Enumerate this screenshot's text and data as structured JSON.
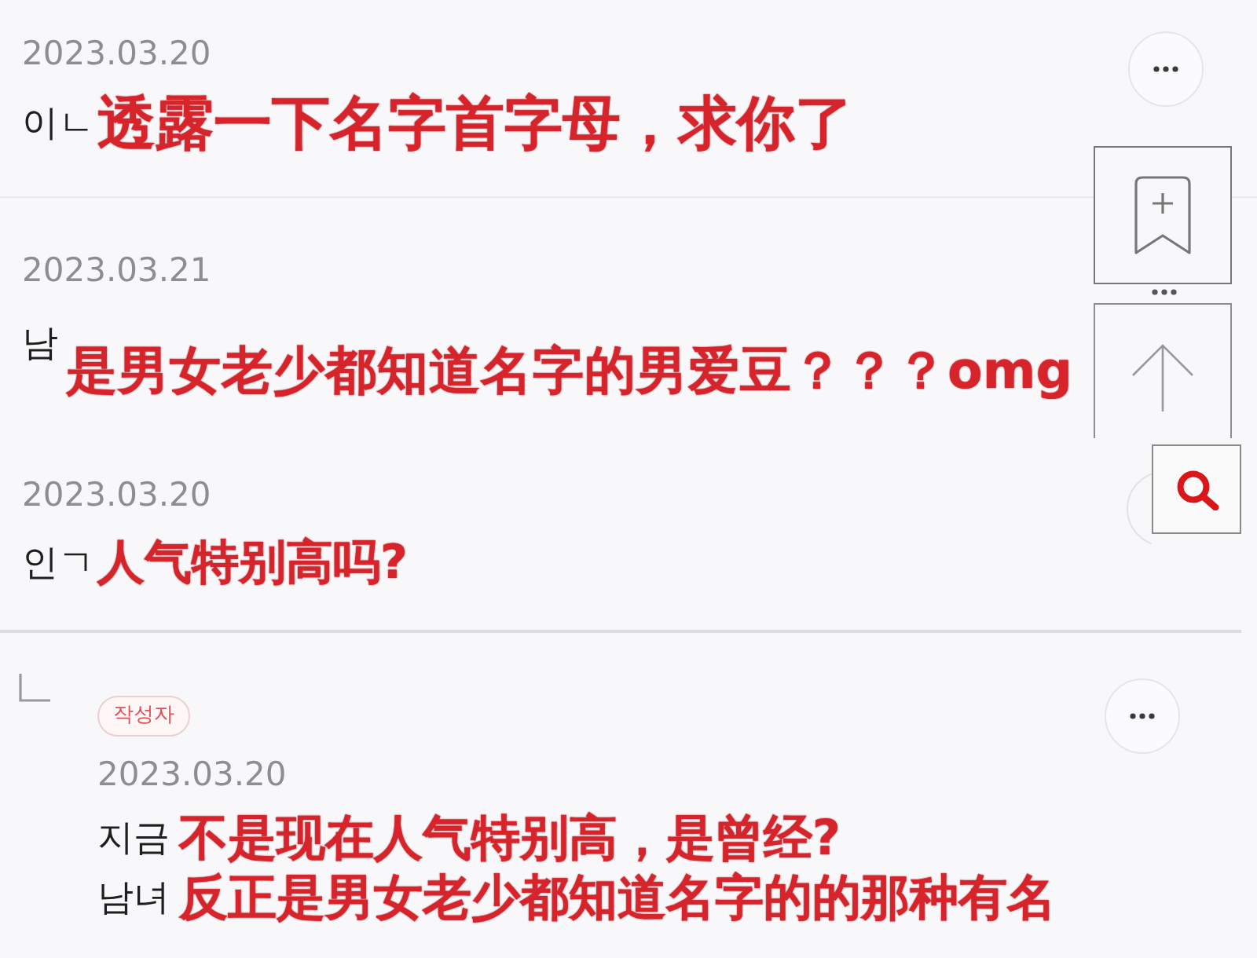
{
  "comments": [
    {
      "date": "2023.03.20",
      "text": "이ㄴ",
      "overlay": "透露一下名字首字母，求你了"
    },
    {
      "date": "2023.03.21",
      "text": "남",
      "overlay": "是男女老少都知道名字的男爱豆？？？omg"
    },
    {
      "date": "2023.03.20",
      "text": "인ㄱ",
      "overlay": "人气特别高吗?"
    }
  ],
  "reply": {
    "badge": "작성자",
    "date": "2023.03.20",
    "lines": [
      {
        "text": "지금",
        "overlay": "不是现在人气特别高，是曾经?"
      },
      {
        "text": "남녀",
        "overlay": "反正是男女老少都知道名字的的那种有名"
      }
    ]
  }
}
